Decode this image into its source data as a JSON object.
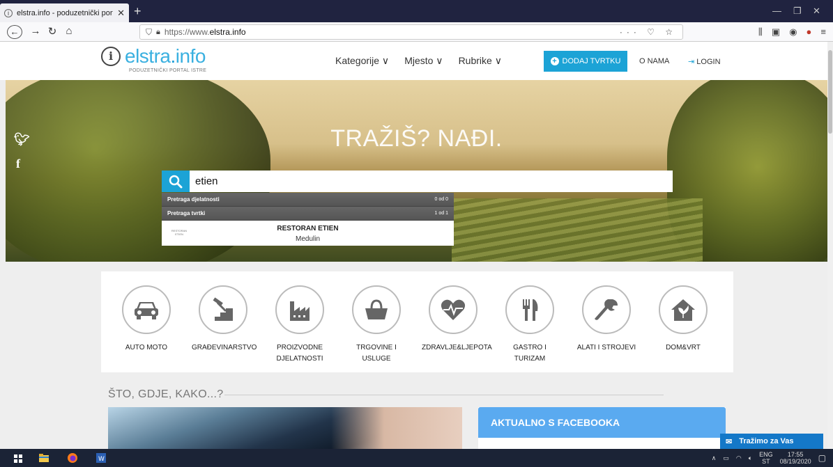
{
  "browser": {
    "tab_title": "elstra.info - poduzetnički porta",
    "tab_close": "✕",
    "new_tab": "+",
    "url_prefix": "https://www.",
    "url_domain": "elstra.info",
    "url_icons": "··· ♡ ☆"
  },
  "header": {
    "logo_main": "elstra",
    "logo_ext": "info",
    "logo_sub": "PODUZETNIČKI PORTAL ISTRE",
    "nav": [
      "Kategorije ∨",
      "Mjesto ∨",
      "Rubrike ∨"
    ],
    "add_button": "DODAJ TVRTKU",
    "about": "O NAMA",
    "login": "LOGIN"
  },
  "hero": {
    "title": "TRAŽIŠ? NAĐI."
  },
  "search": {
    "value": "etien",
    "groups": [
      {
        "label": "Pretraga djelatnosti",
        "count": "0 od 0"
      },
      {
        "label": "Pretraga tvrtki",
        "count": "1 od 1"
      }
    ],
    "result": {
      "thumb": "RESTORAN ETIEN",
      "name": "RESTORAN ETIEN",
      "place": "Medulin"
    }
  },
  "categories": [
    {
      "label": "AUTO MOTO",
      "icon": "car-icon"
    },
    {
      "label": "GRAĐEVINARSTVO",
      "icon": "hammer-stairs-icon"
    },
    {
      "label": "PROIZVODNE\nDJELATNOSTI",
      "icon": "factory-icon"
    },
    {
      "label": "TRGOVINE I\nUSLUGE",
      "icon": "shopping-basket-icon"
    },
    {
      "label": "ZDRAVLJE&LJEPOTA",
      "icon": "heart-pulse-icon"
    },
    {
      "label": "GASTRO I\nTURIZAM",
      "icon": "fork-knife-icon"
    },
    {
      "label": "ALATI I STROJEVI",
      "icon": "wrench-icon"
    },
    {
      "label": "DOM&VRT",
      "icon": "house-plant-icon"
    }
  ],
  "section": {
    "title": "ŠTO, GDJE, KAKO...?",
    "facebook_title": "AKTUALNO S FACEBOOKA"
  },
  "chat": {
    "label": "Tražimo za Vas"
  },
  "taskbar": {
    "lang": "ENG",
    "lang2": "ST",
    "time": "17:55",
    "date": "08/19/2020"
  },
  "colors": {
    "accent": "#1ca3d6",
    "facebook": "#5aaaf0",
    "chat": "#1478c8"
  }
}
